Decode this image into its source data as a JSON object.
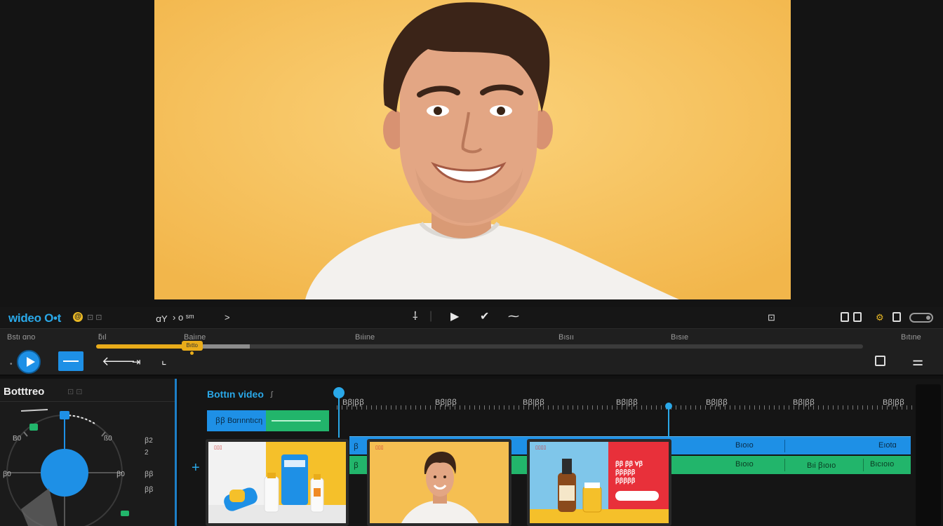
{
  "app": {
    "brand": "wideo O•t",
    "brand_badge": "@",
    "brand_extra": "⊡ ⊡"
  },
  "transport": {
    "left_a": "ꭤΥ",
    "left_b": "› ο ˢᵐ",
    "left_c": ">",
    "icons": [
      "cut-icon",
      "play-icon",
      "check-icon",
      "wave-icon"
    ],
    "right_a": "⊡",
    "right_b": "⊡ ⊡",
    "right_c": "⊕ ⊡ ⊡"
  },
  "ruler": {
    "labels": [
      "Bstı ɑno",
      "ƃıl",
      "Baiıne",
      "Bıiıne",
      "Bısıı",
      "Bısıe",
      "Bıtıne"
    ],
    "scrub_handle": "Bıtto",
    "progress": 0.115,
    "buffered": 0.2
  },
  "left_panel": {
    "title": "Botttreo",
    "title_extra": "⊡ ⊡",
    "dial_labels": [
      "B0",
      "ß0",
      "ꞵ2",
      "2",
      "ꞵ0",
      "ꞵ0",
      "ꞵꞵ",
      "ꞵꞵ"
    ],
    "dial_accent": "#1e90e6"
  },
  "timeline": {
    "title": "Bottın video",
    "title_extra": "ꭍ",
    "tick_labels": [
      "Bꞵ|ꞵꞵ",
      "Bꞵ|ꞵꞵ",
      "Bꞵ|ꞵꞵ",
      "Bꞵ|ꞵꞵ",
      "Bꞵ|ꞵꞵ",
      "Bꞵ|ꞵꞵ",
      "Bꞵ|ꞵꞵ"
    ],
    "clip_a_label": "ꞵꞵ Bɑrınntıcη",
    "blue_track_labels": [
      "Bıoıo",
      "Eıotɑ"
    ],
    "green_track_labels": [
      "Bıoıo",
      "Bıi ꞵıoıo",
      "Bıcıoıo"
    ],
    "thumb_tags": [
      "▯▯▯",
      "▯▯▯",
      "▯▯▯▯"
    ],
    "ad_text": [
      "ꞵꞵ ꞵꞵ Ɐꞵ",
      "ꞵꞵꞵꞵꞵ",
      "ꞵꞵꞵꞵꞵ"
    ]
  },
  "colors": {
    "accent_blue": "#1e90e6",
    "accent_green": "#22b56b",
    "accent_yellow": "#e9ac1a",
    "preview_bg": "#f5bf52"
  }
}
